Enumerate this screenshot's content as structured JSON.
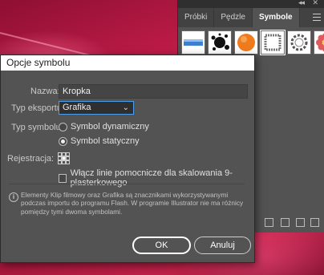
{
  "panel": {
    "tabs": [
      {
        "label": "Próbki",
        "active": false
      },
      {
        "label": "Pędzle",
        "active": false
      },
      {
        "label": "Symbole",
        "active": true
      }
    ],
    "collapse_icon": "double-chevron-icon",
    "close_icon": "close-icon",
    "menu_icon": "panel-menu-icon",
    "symbols": [
      "blue-banner-symbol",
      "ink-splat-symbol",
      "orange-dot-symbol",
      "rope-frame-symbol",
      "gear-frame-symbol",
      "flower-symbol"
    ]
  },
  "dialog": {
    "title": "Opcje symbolu",
    "name_label": "Nazwa:",
    "name_value": "Kropka",
    "export_label": "Typ eksportu:",
    "export_value": "Grafika",
    "symbol_type_label": "Typ symbolu:",
    "radio_dynamic": "Symbol dynamiczny",
    "radio_static": "Symbol statyczny",
    "selected_type": "static",
    "registration_label": "Rejestracja:",
    "guides_checkbox": "Włącz linie pomocnicze dla skalowania 9-plasterkowego",
    "guides_checked": false,
    "info_text": "Elementy Klip filmowy oraz Grafika są znacznikami wykorzystywanymi podczas importu do programu Flash. W programie Illustrator nie ma różnicy pomiędzy tymi dwoma symbolami.",
    "ok_label": "OK",
    "cancel_label": "Anuluj"
  },
  "colors": {
    "accent": "#4d9eea",
    "panel_bg": "#535353",
    "artwork": "#c81e4c"
  }
}
